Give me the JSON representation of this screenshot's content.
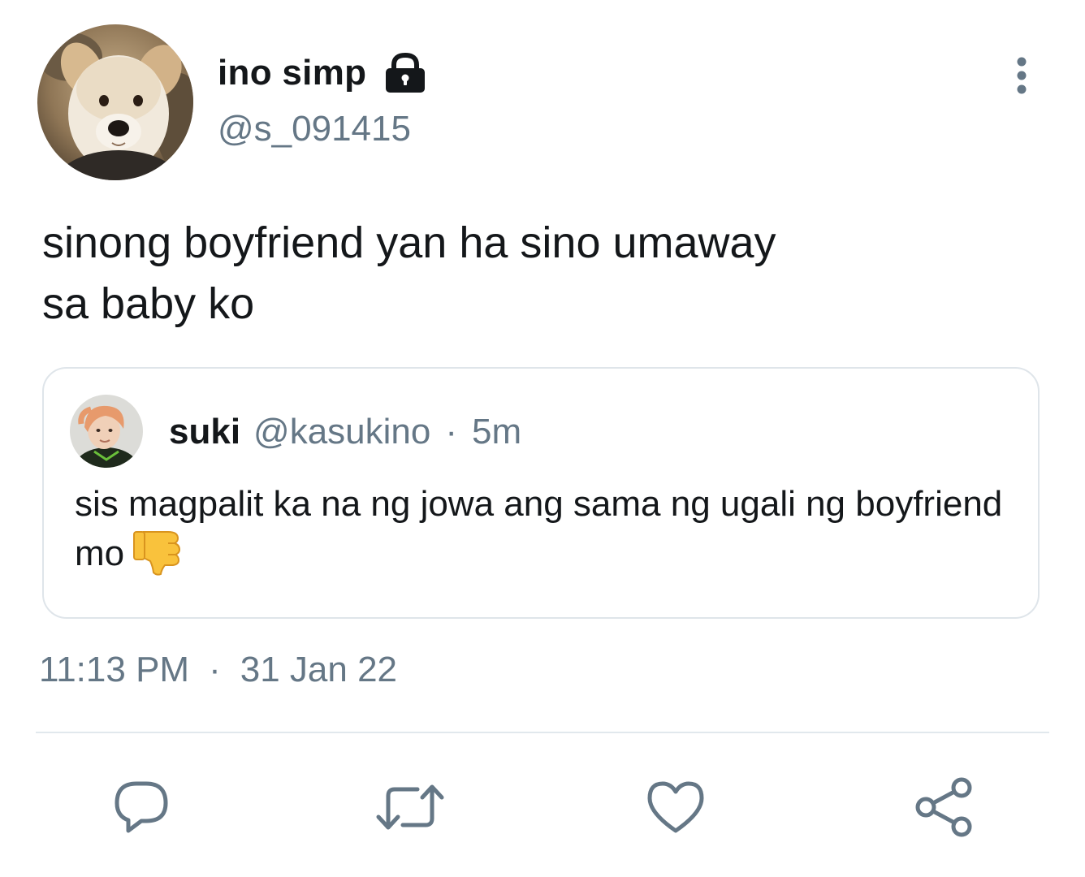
{
  "author": {
    "display_name": "ino simp",
    "handle": "@s_091415",
    "avatar": "dog-avatar",
    "protected_icon": "lock-icon"
  },
  "tweet": {
    "text": "sinong boyfriend yan ha sino umaway\nsa baby ko",
    "time": "11:13 PM",
    "separator": "·",
    "date": "31 Jan 22"
  },
  "quoted_tweet": {
    "display_name": "suki",
    "handle": "@kasukino",
    "separator": "·",
    "time": "5m",
    "text": "sis magpalit ka na ng jowa ang sama ng ugali ng boyfriend mo",
    "emoji": "thumbs-down-icon"
  },
  "actions": {
    "icons": [
      "reply-icon",
      "retweet-icon",
      "like-icon",
      "share-icon"
    ],
    "icon_color": "#657786"
  },
  "colors": {
    "text_primary": "#14171a",
    "text_secondary": "#657786",
    "border": "#dfe5ea"
  }
}
